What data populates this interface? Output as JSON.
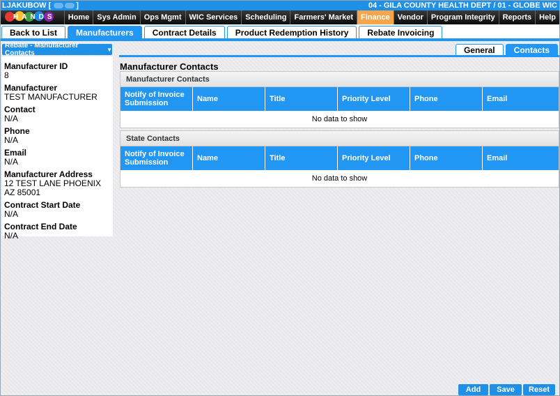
{
  "user": "LJAKUBOW [",
  "user_suffix": "]",
  "agency": "04 - GILA COUNTY HEALTH DEPT / 01 - GLOBE WIC",
  "logo_text": "HANDS",
  "nav": [
    "Home",
    "Sys Admin",
    "Ops Mgmt",
    "WIC Services",
    "Scheduling",
    "Farmers' Market",
    "Finance",
    "Vendor",
    "Program Integrity",
    "Reports",
    "Help"
  ],
  "nav_active": "Finance",
  "tabs": [
    "Back to List",
    "Manufacturers",
    "Contract Details",
    "Product Redemption History",
    "Rebate Invoicing"
  ],
  "tab_active": "Manufacturers",
  "dropdown": {
    "label": "Rebate - Manufacturer Contacts"
  },
  "fields": [
    {
      "label": "Manufacturer ID",
      "value": "8"
    },
    {
      "label": "Manufacturer",
      "value": "TEST MANUFACTURER"
    },
    {
      "label": "Contact",
      "value": "N/A"
    },
    {
      "label": "Phone",
      "value": "N/A"
    },
    {
      "label": "Email",
      "value": "N/A"
    },
    {
      "label": "Manufacturer Address",
      "value": "12 TEST LANE PHOENIX AZ 85001"
    },
    {
      "label": "Contract Start Date",
      "value": "N/A"
    },
    {
      "label": "Contract End Date",
      "value": "N/A"
    }
  ],
  "right_tabs": [
    "General",
    "Contacts"
  ],
  "right_tab_active": "Contacts",
  "section_title": "Manufacturer Contacts",
  "columns": [
    "Notify of Invoice Submission",
    "Name",
    "Title",
    "Priority Level",
    "Phone",
    "Email"
  ],
  "grids": [
    {
      "title": "Manufacturer Contacts",
      "empty_text": "No data to show"
    },
    {
      "title": "State Contacts",
      "empty_text": "No data to show"
    }
  ],
  "buttons": [
    "Add",
    "Save",
    "Reset"
  ],
  "colors": {
    "primary": "#2196f3",
    "active_nav": "#f7a54a",
    "topbar": "#1e90e6"
  }
}
